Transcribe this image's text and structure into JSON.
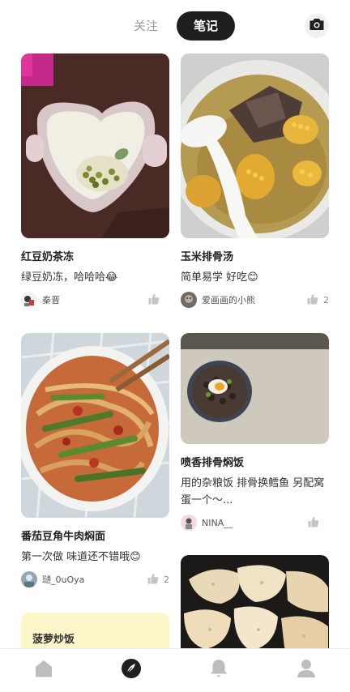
{
  "header": {
    "tab_follow": "关注",
    "tab_notes": "笔记",
    "active_tab": "笔记",
    "camera_icon": "camera-icon"
  },
  "feed": {
    "left": [
      {
        "title": "红豆奶茶冻",
        "desc": "绿豆奶冻，哈哈哈😂",
        "author": "秦晋",
        "likes": "",
        "image": "heart-bowl-mung-bean-dessert"
      },
      {
        "title": "番茄豆角牛肉焖面",
        "desc": "第一次做 味道还不错哦😊",
        "author": "琎_0uOya",
        "likes": "2",
        "image": "noodles-with-green-beans"
      }
    ],
    "right": [
      {
        "title": "玉米排骨汤",
        "desc": "简单易学 好吃😊",
        "author": "爱画画的小熊",
        "likes": "2",
        "image": "corn-pork-rib-soup"
      },
      {
        "title": "喷香排骨焖饭",
        "desc": "用的杂粮饭 排骨换鳕鱼 另配窝蛋一个～...",
        "author": "NINA__",
        "likes": "",
        "image": "rice-bowl-with-egg"
      },
      {
        "title": "",
        "desc": "",
        "author": "",
        "likes": "",
        "image": "fried-fish-pieces"
      }
    ],
    "text_card": {
      "title": "菠萝炒饭"
    }
  },
  "bottom_nav": {
    "items": [
      "home-icon",
      "discover-icon",
      "bell-icon",
      "profile-icon"
    ],
    "active": "discover-icon"
  },
  "colors": {
    "accent_dark": "#1f1f1f",
    "text_card_bg": "#fdf6c8",
    "nav_inactive": "#bdbdbd"
  }
}
